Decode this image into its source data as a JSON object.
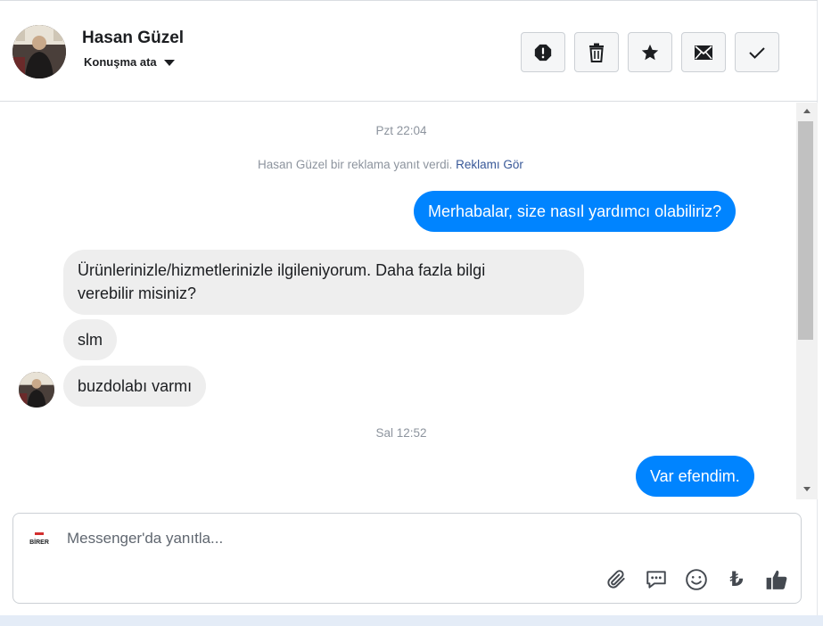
{
  "header": {
    "contact_name": "Hasan Güzel",
    "assign_label": "Konuşma ata",
    "actions": [
      {
        "name": "report-button",
        "icon": "alert-octagon-icon"
      },
      {
        "name": "delete-button",
        "icon": "trash-icon"
      },
      {
        "name": "star-button",
        "icon": "star-icon"
      },
      {
        "name": "mark-unread-button",
        "icon": "envelope-icon"
      },
      {
        "name": "mark-done-button",
        "icon": "check-icon"
      }
    ]
  },
  "thread": {
    "timestamp_1": "Pzt 22:04",
    "system_message": "Hasan Güzel bir reklama yanıt verdi.",
    "system_link": "Reklamı Gör",
    "msg_out_1": "Merhabalar, size nasıl yardımcı olabiliriz?",
    "msg_in_1_line1": "Ürünlerinizle/hizmetlerinizle ilgileniyorum. Daha fazla bilgi",
    "msg_in_1_line2": "verebilir misiniz?",
    "msg_in_2": "slm",
    "msg_in_3": "buzdolabı varmı",
    "timestamp_2": "Sal 12:52",
    "msg_out_2": "Var efendim."
  },
  "composer": {
    "placeholder": "Messenger'da yanıtla...",
    "page_logo_text": "BİRER",
    "currency_symbol": "₺",
    "tools": [
      "paperclip-icon",
      "saved-reply-icon",
      "emoji-icon",
      "lira-icon",
      "thumbs-up-icon"
    ]
  },
  "colors": {
    "outgoing_bubble": "#0084ff",
    "incoming_bubble": "#eeeeee",
    "link": "#385898"
  }
}
